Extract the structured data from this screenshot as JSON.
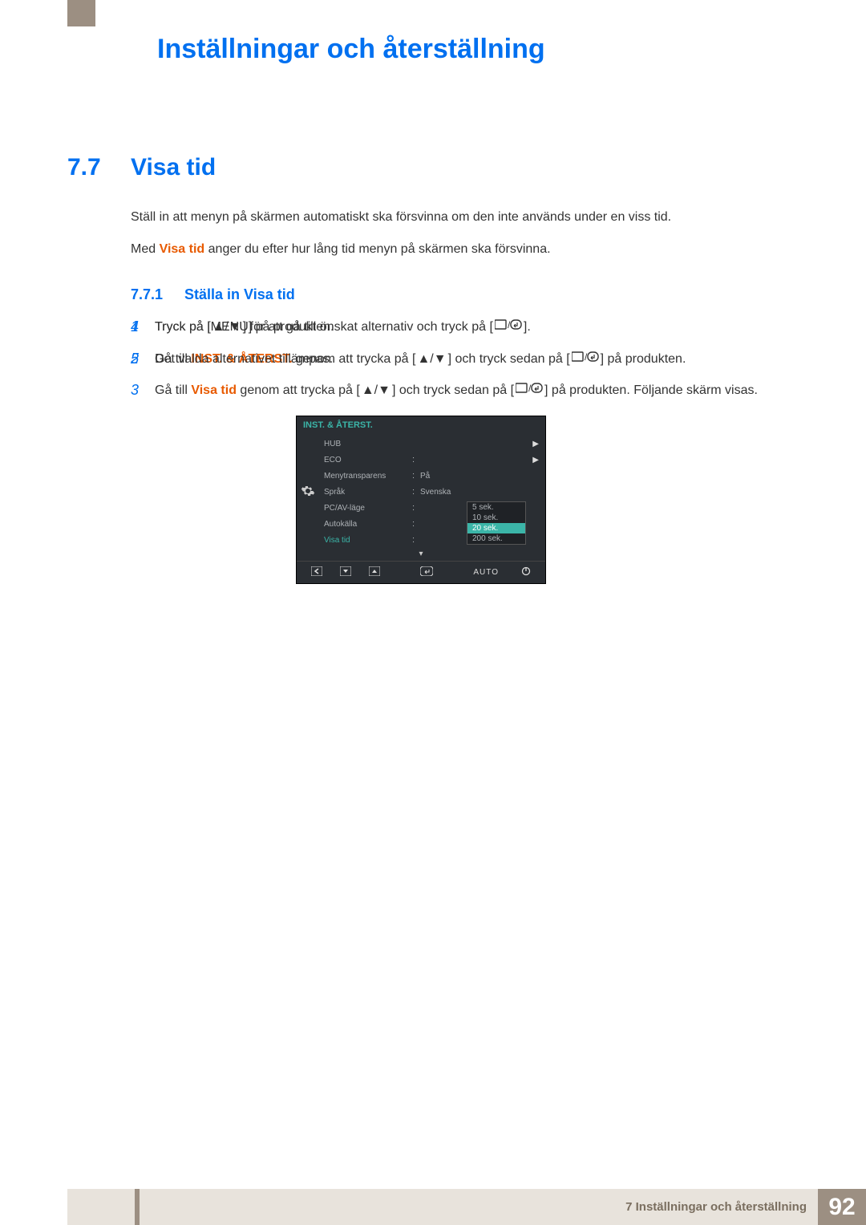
{
  "chapter_title": "Inställningar och återställning",
  "section": {
    "num": "7.7",
    "title": "Visa tid"
  },
  "intro1": "Ställ in att menyn på skärmen automatiskt ska försvinna om den inte används under en viss tid.",
  "intro2_pre": "Med ",
  "intro2_em": "Visa tid",
  "intro2_post": " anger du efter hur lång tid menyn på skärmen ska försvinna.",
  "subsection": {
    "num": "7.7.1",
    "title": "Ställa in Visa tid"
  },
  "steps": {
    "s1_pre": "Tryck på [",
    "s1_menu": "MENU",
    "s1_post": "] på produkten.",
    "s2_pre": "Gå till ",
    "s2_em": "INST. & ÅTERST.",
    "s2_mid": " genom att trycka på [",
    "s2_mid2": "] och tryck sedan på [",
    "s2_post": "] på produkten.",
    "s3_pre": "Gå till ",
    "s3_em": "Visa tid",
    "s3_mid": " genom att trycka på [",
    "s3_mid2": "] och tryck sedan på [",
    "s3_post": "] på produkten. Följande skärm visas.",
    "s4_pre": "Tryck på [",
    "s4_mid": "] för att gå till önskat alternativ och tryck på [",
    "s4_post": "].",
    "s5": "Det valda alternativet tillämpas."
  },
  "osd": {
    "header": "INST. & ÅTERST.",
    "rows": [
      {
        "label": "HUB",
        "val": "",
        "arrow": true
      },
      {
        "label": "ECO",
        "val": "",
        "colon": true,
        "arrow": true
      },
      {
        "label": "Menytransparens",
        "val": "På",
        "colon": true
      },
      {
        "label": "Språk",
        "val": "Svenska",
        "colon": true
      },
      {
        "label": "PC/AV-läge",
        "val": "",
        "colon": true
      },
      {
        "label": "Autokälla",
        "val": "",
        "colon": true
      },
      {
        "label": "Visa tid",
        "val": "",
        "colon": true,
        "active": true
      }
    ],
    "dropdown": [
      "5 sek.",
      "10 sek.",
      "20 sek.",
      "200 sek."
    ],
    "dropdown_sel_index": 2,
    "footer_auto": "AUTO"
  },
  "footer": {
    "chapter": "7 Inställningar och återställning",
    "page": "92"
  }
}
